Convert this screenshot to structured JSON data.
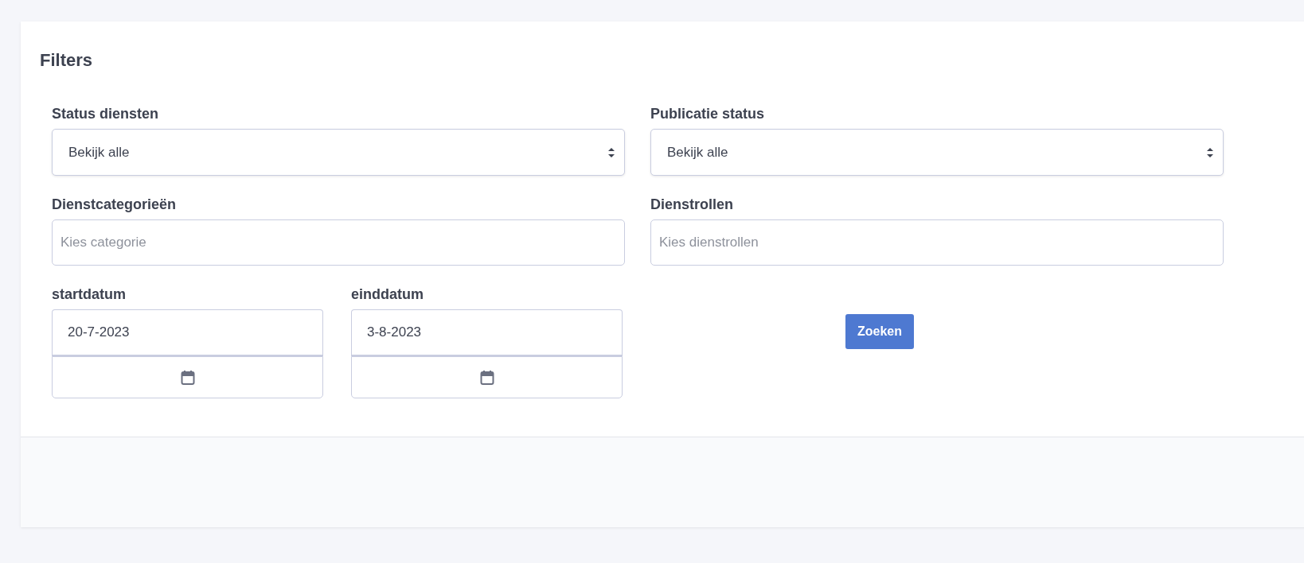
{
  "card": {
    "title": "Filters"
  },
  "filters": [
    {
      "kind": "select",
      "label": "Status diensten",
      "value": "Bekijk alle"
    },
    {
      "kind": "select",
      "label": "Publicatie status",
      "value": "Bekijk alle"
    },
    {
      "kind": "text",
      "label": "Dienstcategorieën",
      "placeholder": "Kies categorie"
    },
    {
      "kind": "text",
      "label": "Dienstrollen",
      "placeholder": "Kies dienstrollen"
    }
  ],
  "dates": [
    {
      "label": "startdatum",
      "value": "20-7-2023"
    },
    {
      "label": "einddatum",
      "value": "3-8-2023"
    }
  ],
  "search_button": "Zoeken"
}
